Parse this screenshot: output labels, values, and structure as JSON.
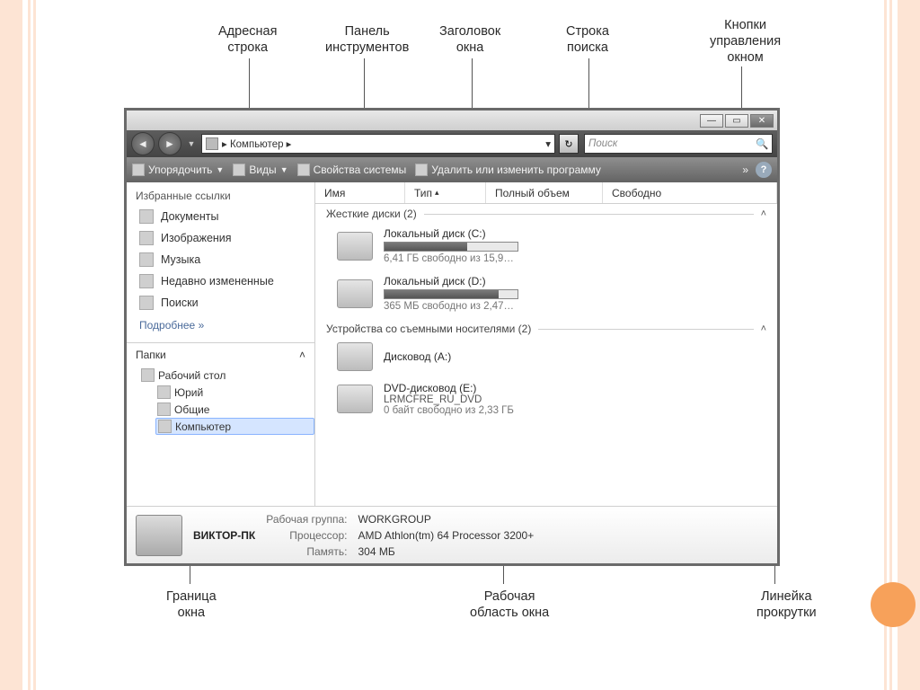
{
  "callouts": {
    "address": "Адресная\nстрока",
    "toolbar": "Панель\nинструментов",
    "title": "Заголовок\nокна",
    "search": "Строка\nпоиска",
    "controls": "Кнопки\nуправления\nокном",
    "border": "Граница\nокна",
    "workarea": "Рабочая\nобласть окна",
    "scrollbar": "Линейка\nпрокрутки"
  },
  "address": {
    "path": "▸ Компьютер ▸",
    "dropdown": "▾"
  },
  "search": {
    "placeholder": "Поиск"
  },
  "toolbar": {
    "organize": "Упорядочить",
    "views": "Виды",
    "sysprops": "Свойства системы",
    "uninstall": "Удалить или изменить программу",
    "more": "»"
  },
  "sidebar": {
    "fav_header": "Избранные ссылки",
    "items": [
      {
        "label": "Документы"
      },
      {
        "label": "Изображения"
      },
      {
        "label": "Музыка"
      },
      {
        "label": "Недавно измененные"
      },
      {
        "label": "Поиски"
      }
    ],
    "more": "Подробнее  »",
    "folders_header": "Папки",
    "tree": {
      "desktop": "Рабочий стол",
      "user": "Юрий",
      "public": "Общие",
      "computer": "Компьютер"
    }
  },
  "columns": {
    "name": "Имя",
    "type": "Тип",
    "total": "Полный объем",
    "free": "Свободно"
  },
  "sections": {
    "hdd": "Жесткие диски (2)",
    "removable": "Устройства со съемными носителями (2)"
  },
  "drives": {
    "c": {
      "name": "Локальный диск (C:)",
      "free": "6,41 ГБ свободно из 15,9…",
      "fill": 62
    },
    "d": {
      "name": "Локальный диск (D:)",
      "free": "365 МБ свободно из 2,47…",
      "fill": 86
    },
    "a": {
      "name": "Дисковод (A:)"
    },
    "e": {
      "name": "DVD-дисковод (E:)",
      "label": "LRMCFRE_RU_DVD",
      "free": "0 байт свободно из 2,33 ГБ"
    }
  },
  "details": {
    "pcname": "ВИКТОР-ПК",
    "workgroup_l": "Рабочая группа:",
    "workgroup_v": "WORKGROUP",
    "cpu_l": "Процессор:",
    "cpu_v": "AMD Athlon(tm) 64 Processor 3200+",
    "mem_l": "Память:",
    "mem_v": "304 МБ"
  }
}
